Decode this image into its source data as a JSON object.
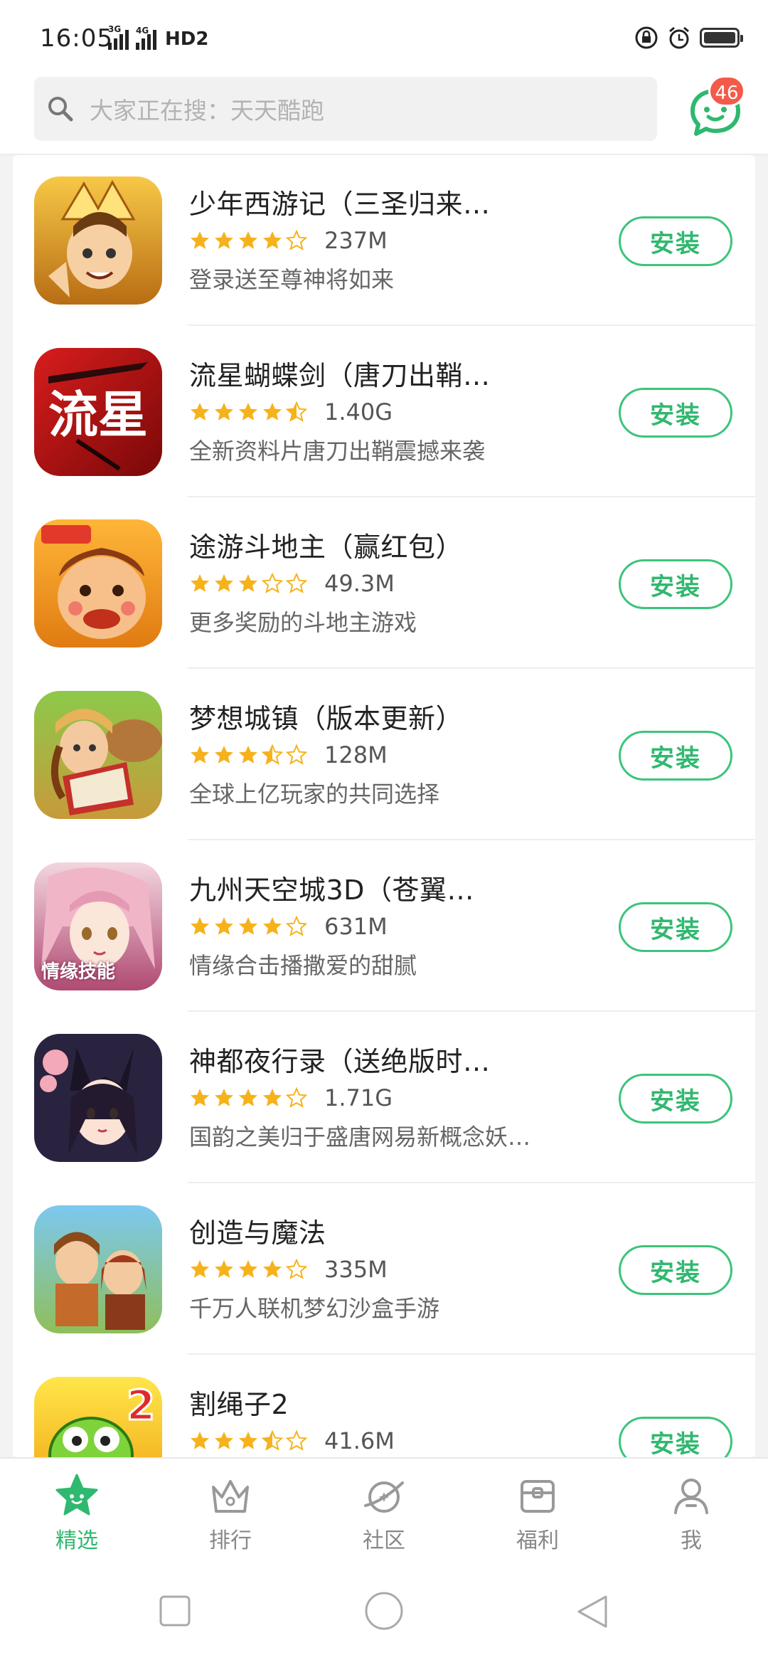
{
  "status_bar": {
    "time": "16:05",
    "net1": "3G",
    "net2": "4G",
    "hd": "HD2"
  },
  "search": {
    "placeholder": "大家正在搜：天天酷跑"
  },
  "messages": {
    "badge_count": "46"
  },
  "apps": [
    {
      "name": "少年西游记（三圣归来…",
      "rating": 4,
      "size": "237M",
      "desc": "登录送至尊神将如来",
      "install_label": "安装",
      "icon": "game-icon-shaonian"
    },
    {
      "name": "流星蝴蝶剑（唐刀出鞘…",
      "rating": 4.5,
      "size": "1.40G",
      "desc": "全新资料片唐刀出鞘震撼来袭",
      "install_label": "安装",
      "icon": "game-icon-liuxing"
    },
    {
      "name": "途游斗地主（赢红包）",
      "rating": 3,
      "size": "49.3M",
      "desc": "更多奖励的斗地主游戏",
      "install_label": "安装",
      "icon": "game-icon-doudizhu"
    },
    {
      "name": "梦想城镇（版本更新）",
      "rating": 3.5,
      "size": "128M",
      "desc": "全球上亿玩家的共同选择",
      "install_label": "安装",
      "icon": "game-icon-mengxiang"
    },
    {
      "name": "九州天空城3D（苍翼…",
      "rating": 4,
      "size": "631M",
      "desc": "情缘合击播撒爱的甜腻",
      "install_label": "安装",
      "icon": "game-icon-jiuzhou",
      "icon_caption": "情缘技能"
    },
    {
      "name": "神都夜行录（送绝版时…",
      "rating": 4,
      "size": "1.71G",
      "desc": "国韵之美归于盛唐网易新概念妖…",
      "install_label": "安装",
      "icon": "game-icon-shendu"
    },
    {
      "name": "创造与魔法",
      "rating": 4,
      "size": "335M",
      "desc": "千万人联机梦幻沙盒手游",
      "install_label": "安装",
      "icon": "game-icon-chuangzao"
    },
    {
      "name": "割绳子2",
      "rating": 3.5,
      "size": "41.6M",
      "desc": "",
      "install_label": "安装",
      "icon": "game-icon-gesheng"
    }
  ],
  "bottom_nav": [
    {
      "label": "精选",
      "icon": "star-icon",
      "active": true
    },
    {
      "label": "排行",
      "icon": "crown-icon",
      "active": false
    },
    {
      "label": "社区",
      "icon": "planet-icon",
      "active": false
    },
    {
      "label": "福利",
      "icon": "gift-box-icon",
      "active": false
    },
    {
      "label": "我",
      "icon": "user-icon",
      "active": false
    }
  ],
  "colors": {
    "accent_green": "#31b86f",
    "star_gold": "#f6b21b",
    "badge_red": "#f45a4a"
  }
}
